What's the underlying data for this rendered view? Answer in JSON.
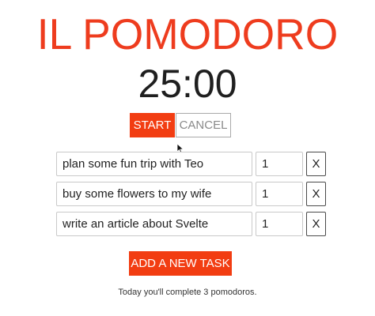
{
  "app": {
    "title": "IL POMODORO",
    "timer": "25:00"
  },
  "controls": {
    "start_label": "START",
    "cancel_label": "CANCEL"
  },
  "tasks": [
    {
      "name": "plan some fun trip with Teo",
      "pomodoros": "1",
      "remove_label": "X"
    },
    {
      "name": "buy some flowers to my wife",
      "pomodoros": "1",
      "remove_label": "X"
    },
    {
      "name": "write an article about Svelte",
      "pomodoros": "1",
      "remove_label": "X"
    }
  ],
  "add_task_label": "ADD A NEW TASK",
  "summary": "Today you'll complete 3 pomodoros.",
  "colors": {
    "accent": "#f23d12",
    "title": "#ee3c1e"
  }
}
